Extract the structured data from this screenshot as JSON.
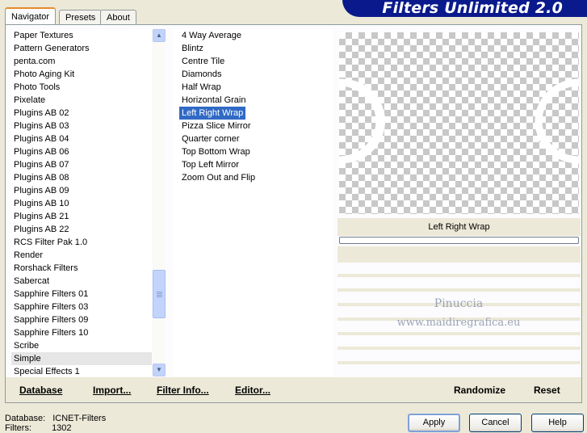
{
  "tabs": [
    {
      "label": "Navigator",
      "active": true
    },
    {
      "label": "Presets",
      "active": false
    },
    {
      "label": "About",
      "active": false
    }
  ],
  "banner_title": "Filters Unlimited 2.0",
  "categories": [
    "Paper Textures",
    "Pattern Generators",
    "penta.com",
    "Photo Aging Kit",
    "Photo Tools",
    "Pixelate",
    "Plugins AB 02",
    "Plugins AB 03",
    "Plugins AB 04",
    "Plugins AB 06",
    "Plugins AB 07",
    "Plugins AB 08",
    "Plugins AB 09",
    "Plugins AB 10",
    "Plugins AB 21",
    "Plugins AB 22",
    "RCS Filter Pak 1.0",
    "Render",
    "Rorshack Filters",
    "Sabercat",
    "Sapphire Filters 01",
    "Sapphire Filters 03",
    "Sapphire Filters 09",
    "Sapphire Filters 10",
    "Scribe",
    "Simple",
    "Special Effects 1"
  ],
  "selected_category": "Simple",
  "filters": [
    "4 Way Average",
    "Blintz",
    "Centre Tile",
    "Diamonds",
    "Half Wrap",
    "Horizontal Grain",
    "Left Right Wrap",
    "Pizza Slice Mirror",
    "Quarter corner",
    "Top Bottom Wrap",
    "Top Left Mirror",
    "Zoom Out and Flip"
  ],
  "selected_filter": "Left Right Wrap",
  "preview": {
    "filter_name": "Left Right Wrap",
    "progress_fraction": 0
  },
  "watermark": {
    "line1": "Pinuccia",
    "line2": "www.maidiregrafica.eu"
  },
  "bottom_buttons": {
    "database": "Database",
    "import": "Import...",
    "filter_info": "Filter Info...",
    "editor": "Editor...",
    "randomize": "Randomize",
    "reset": "Reset"
  },
  "status": {
    "database_label": "Database:",
    "database_value": "ICNET-Filters",
    "filters_label": "Filters:",
    "filters_value": "1302"
  },
  "dialog_buttons": {
    "apply": "Apply",
    "cancel": "Cancel",
    "help": "Help"
  },
  "colors": {
    "banner": "#0a1a8c",
    "selection": "#316ac5",
    "tab_highlight": "#e68b2c"
  }
}
